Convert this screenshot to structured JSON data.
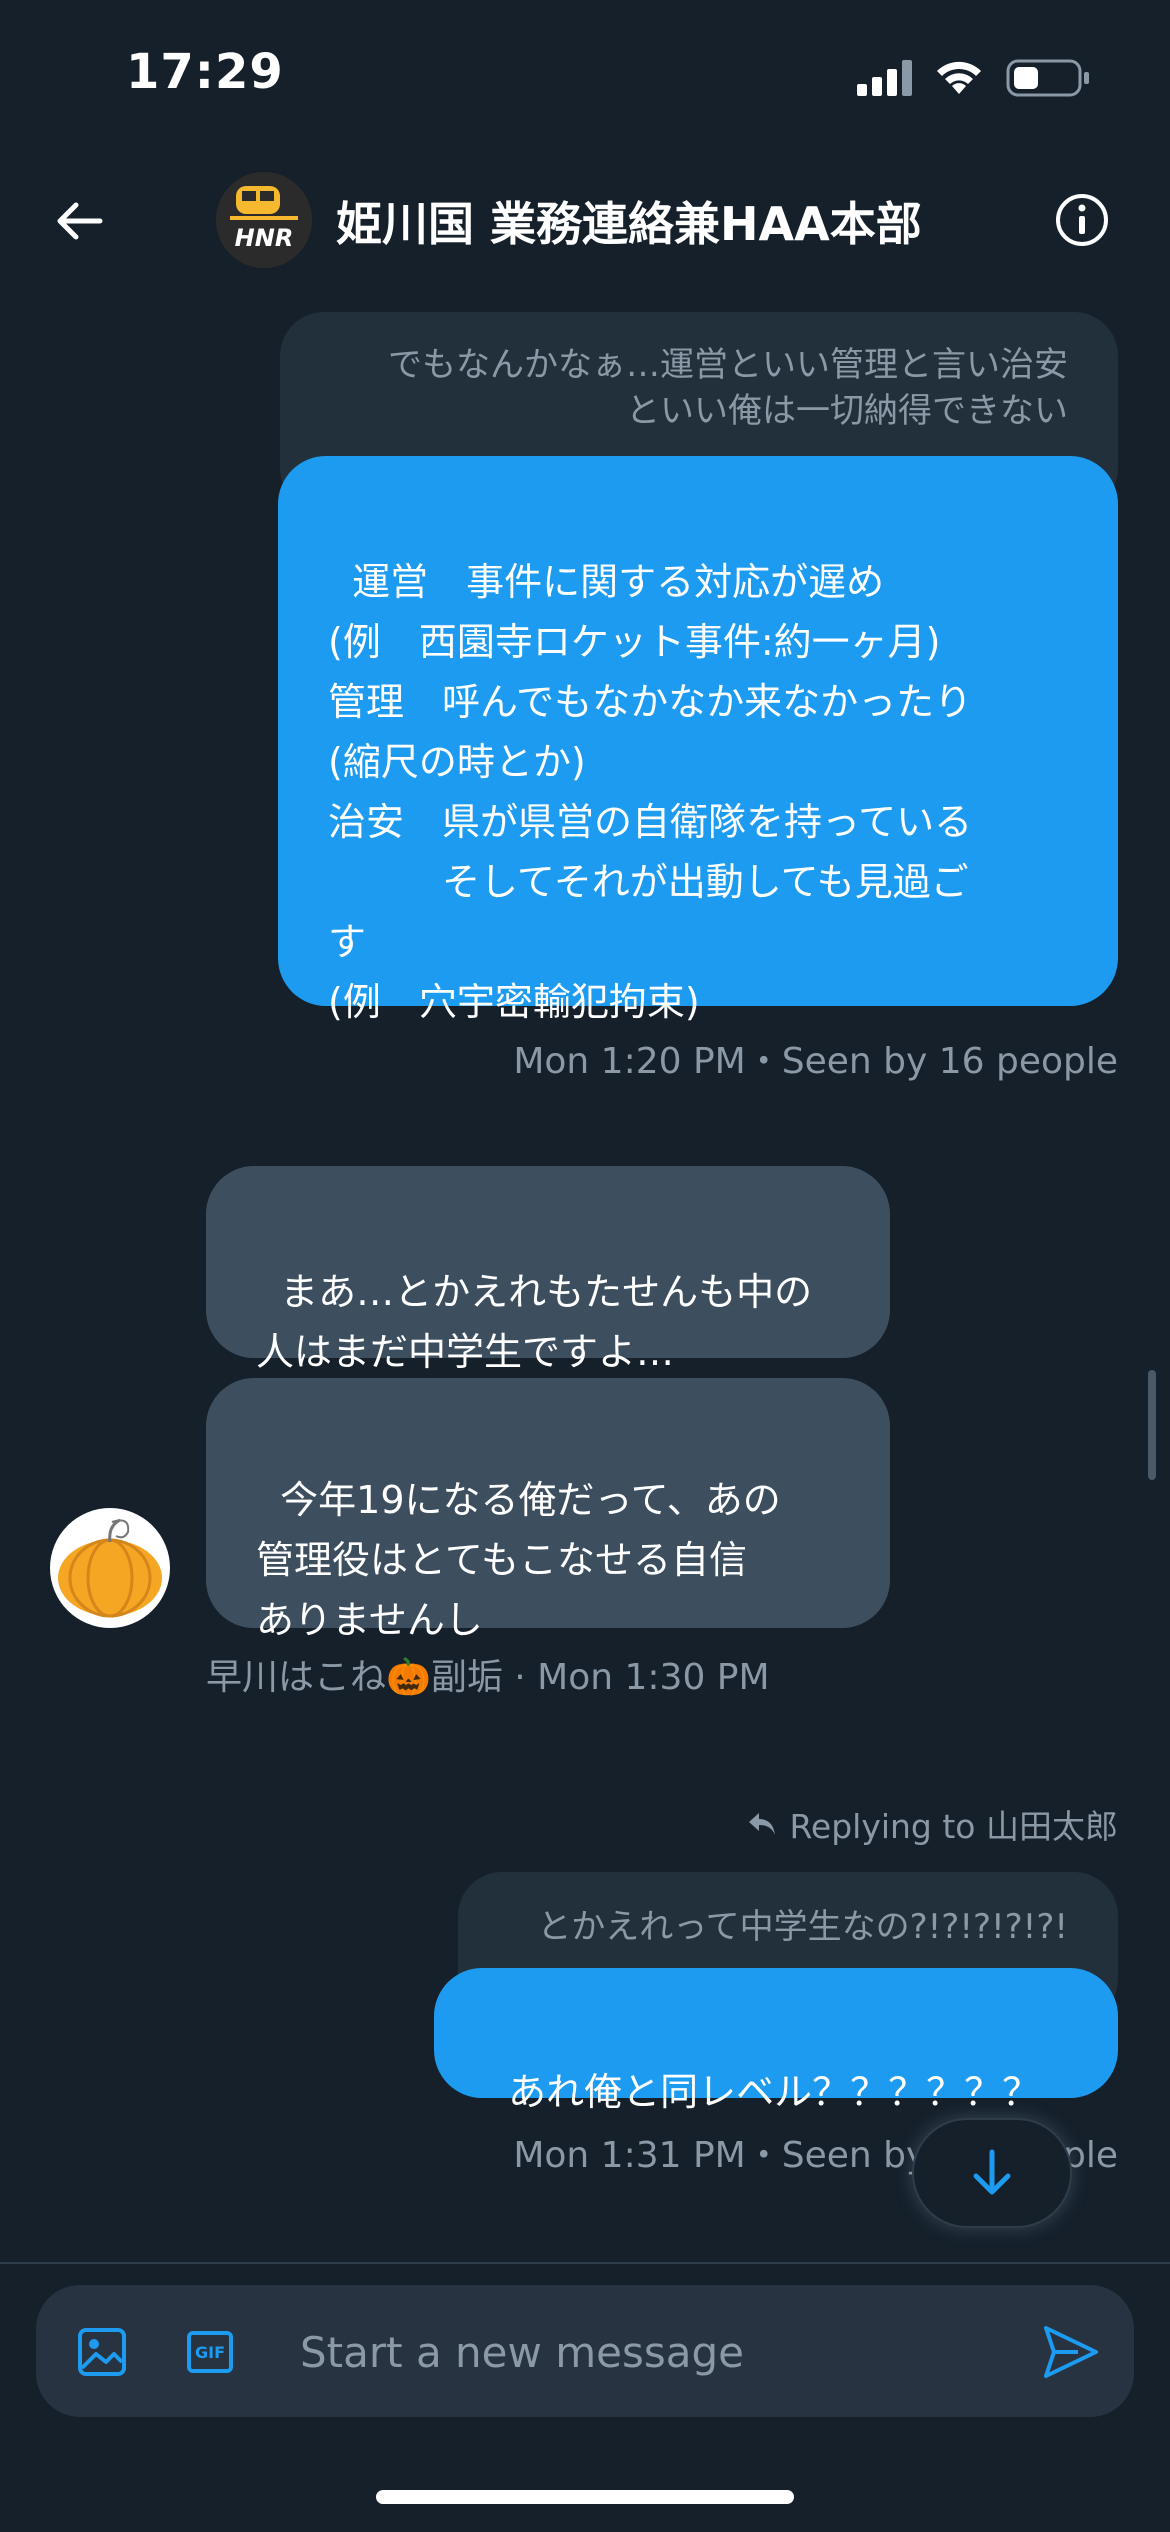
{
  "status_bar": {
    "time": "17:29"
  },
  "header": {
    "title": "姫川国 業務連絡兼HAA本部",
    "avatar_text": "HNR"
  },
  "messages": {
    "m1": {
      "quote": "でもなんかなぁ…運営といい管理と言い治安\nといい俺は一切納得できない",
      "text": "運営　事件に関する対応が遅め\n(例　西園寺ロケット事件:約一ヶ月)\n管理　呼んでもなかなか来なかったり\n(縮尺の時とか)\n治安　県が県営の自衛隊を持っている\n　　　そしてそれが出動しても見過ご\nす\n(例　穴宇密輸犯拘束)",
      "meta": "Mon 1:20 PM・Seen by 16 people"
    },
    "m2": {
      "text": "まあ…とかえれもたせんも中の\n人はまだ中学生ですよ…"
    },
    "m3": {
      "text": "今年19になる俺だって、あの\n管理役はとてもこなせる自信\nありませんし",
      "meta": "早川はこね🎃副垢 · Mon 1:30 PM"
    },
    "m4": {
      "reply_to": "Replying to 山田太郎",
      "quote": "とかえれって中学生なの?!?!?!?!?!",
      "text": "あれ俺と同レベル？？？？？？",
      "meta": "Mon 1:31 PM・Seen by 16 people"
    }
  },
  "composer": {
    "placeholder": "Start a new message",
    "gif_label": "GIF"
  },
  "colors": {
    "background": "#15202b",
    "accent": "#1d9bf0",
    "incoming": "#3d4f5f",
    "muted": "#8b98a5"
  }
}
